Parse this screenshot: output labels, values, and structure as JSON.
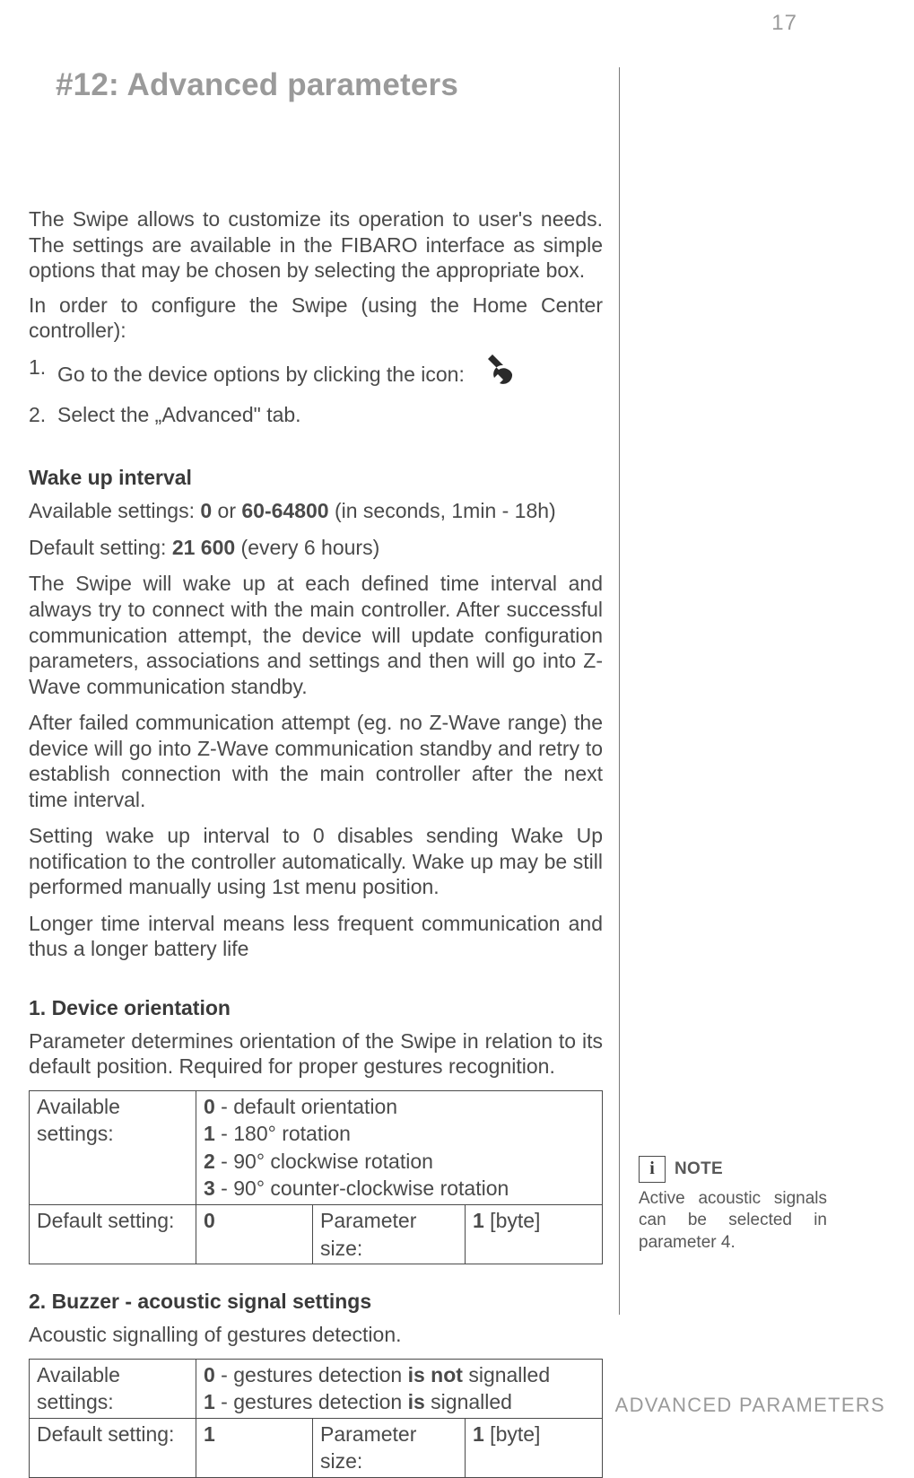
{
  "page_number": "17",
  "section_title": "#12: Advanced parameters",
  "intro": {
    "p1": "The Swipe allows to customize its operation to user's needs. The settings are available in the FIBARO interface as simple options that may be chosen by selecting the appropriate box.",
    "p2": "In order to configure the Swipe (using the Home Center controller):",
    "step1": "Go to the device options by clicking the icon:",
    "step2": "Select the „Advanced\" tab."
  },
  "wakeup": {
    "heading": "Wake up interval",
    "available_label": "Available settings: ",
    "available_v1": "0",
    "available_sep": " or ",
    "available_v2": "60-64800",
    "available_tail": " (in seconds, 1min - 18h)",
    "default_label": "Default setting: ",
    "default_value": "21 600",
    "default_tail": " (every 6 hours)",
    "p1": "The Swipe will wake up at each defined time interval and always try to connect with the main controller. After successful communication attempt, the device will update configuration parameters, associations and settings and then will go into Z-Wave communication standby.",
    "p2": "After failed communication attempt (eg. no Z-Wave range) the device will go into Z-Wave communication standby and retry to establish connection with the main controller after the next time interval.",
    "p3": "Setting wake up interval to 0 disables sending Wake Up notification to the controller automatically. Wake up may be still performed manually using 1st menu position.",
    "p4": "Longer time interval  means less frequent communication and thus a longer battery life"
  },
  "param1": {
    "heading": "1. Device orientation",
    "desc": "Parameter determines orientation of the Swipe in relation to its default position. Required for proper gestures recognition.",
    "tbl": {
      "avail_label": "Available settings:",
      "opt0_a": "0",
      "opt0_b": " - default orientation",
      "opt1_a": "1",
      "opt1_b": " - 180° rotation",
      "opt2_a": "2",
      "opt2_b": " - 90° clockwise rotation",
      "opt3_a": "3",
      "opt3_b": " - 90° counter-clockwise rotation",
      "def_label": "Default setting:",
      "def_val": "0",
      "psize_label": "Parameter size:",
      "psize_val_a": "1",
      "psize_val_b": " [byte]"
    }
  },
  "param2": {
    "heading": "2. Buzzer - acoustic signal settings",
    "desc": "Acoustic signalling of gestures detection.",
    "tbl": {
      "avail_label": "Available settings:",
      "opt0_a": "0",
      "opt0_b": " - gestures detection ",
      "opt0_c": "is not",
      "opt0_d": " signalled",
      "opt1_a": "1",
      "opt1_b": " - gestures detection ",
      "opt1_c": "is",
      "opt1_d": " signalled",
      "def_label": "Default setting:",
      "def_val": "1",
      "psize_label": "Parameter size:",
      "psize_val_a": "1",
      "psize_val_b": " [byte]"
    }
  },
  "note": {
    "badge": "i",
    "title": "NOTE",
    "body": "Active acoustic signals can be selected in parameter 4."
  },
  "footer": "ADVANCED PARAMETERS",
  "icons": {
    "wrench": "wrench-icon"
  }
}
